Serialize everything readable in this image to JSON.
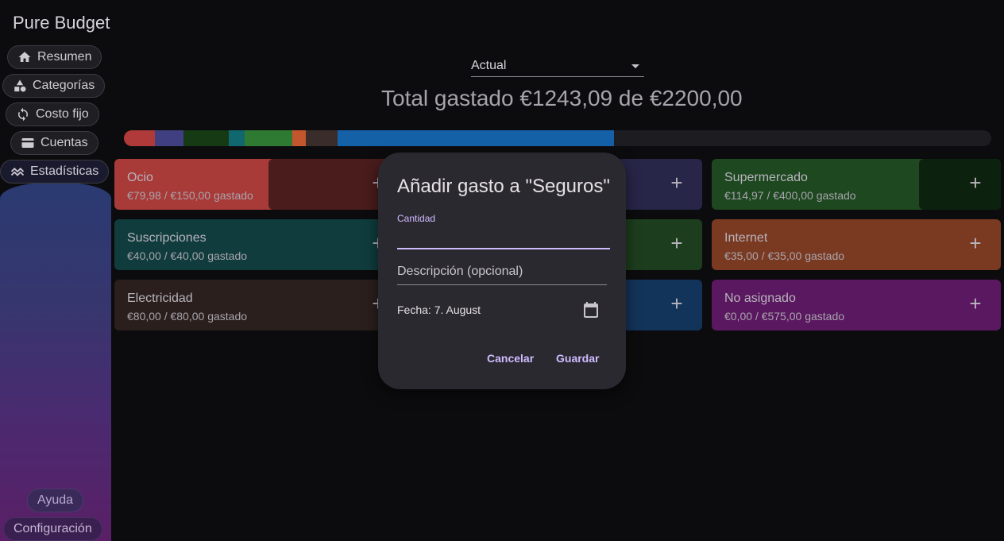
{
  "app": {
    "title": "Pure Budget"
  },
  "sidebar": {
    "items": [
      {
        "label": "Resumen",
        "icon": "home-icon"
      },
      {
        "label": "Categorías",
        "icon": "shapes-icon"
      },
      {
        "label": "Costo fijo",
        "icon": "sync-icon"
      },
      {
        "label": "Cuentas",
        "icon": "wallet-icon"
      },
      {
        "label": "Estadísticas",
        "icon": "stats-icon"
      }
    ],
    "footer": [
      {
        "label": "Ayuda"
      },
      {
        "label": "Configuración"
      }
    ]
  },
  "header": {
    "period": "Actual",
    "total": "Total gastado €1243,09 de €2200,00"
  },
  "budget_bar": {
    "segments": [
      {
        "color": "#b03a3a",
        "share": 0.036
      },
      {
        "color": "#3f3f82",
        "share": 0.033
      },
      {
        "color": "#153a14",
        "share": 0.052
      },
      {
        "color": "#10686e",
        "share": 0.018
      },
      {
        "color": "#2f7a32",
        "share": 0.055
      },
      {
        "color": "#c4562e",
        "share": 0.016
      },
      {
        "color": "#3a2c2a",
        "share": 0.036
      },
      {
        "color": "#1561a8",
        "share": 0.319
      }
    ]
  },
  "categories": [
    {
      "name": "Ocio",
      "amount": "€79,98 / €150,00 gastado",
      "bg": "#a83a38",
      "fill": "#4a1c1c",
      "remaining": 0.467
    },
    {
      "name": "",
      "amount": "",
      "bg": "#272648",
      "fill": "#272648",
      "remaining": 0
    },
    {
      "name": "Supermercado",
      "amount": "€114,97 / €400,00 gastado",
      "bg": "#1e4820",
      "fill": "#0d220e",
      "remaining": 0.283
    },
    {
      "name": "Suscripciones",
      "amount": "€40,00 / €40,00 gastado",
      "bg": "#103c3e",
      "fill": "#103c3e",
      "remaining": 0
    },
    {
      "name": "",
      "amount": "",
      "bg": "#1d3e1e",
      "fill": "#1d3e1e",
      "remaining": 0
    },
    {
      "name": "Internet",
      "amount": "€35,00 / €35,00 gastado",
      "bg": "#7a3a22",
      "fill": "#7a3a22",
      "remaining": 0
    },
    {
      "name": "Electricidad",
      "amount": "€80,00 / €80,00 gastado",
      "bg": "#2a1f1d",
      "fill": "#2a1f1d",
      "remaining": 0
    },
    {
      "name": "",
      "amount": "",
      "bg": "#13345a",
      "fill": "#13345a",
      "remaining": 0
    },
    {
      "name": "No asignado",
      "amount": "€0,00 / €575,00 gastado",
      "bg": "#5a1860",
      "fill": "#5a1860",
      "remaining": 0
    }
  ],
  "dialog": {
    "title": "Añadir gasto a \"Seguros\"",
    "amount_label": "Cantidad",
    "amount_value": "",
    "description_placeholder": "Descripción (opcional)",
    "date_text": "Fecha: 7. August",
    "cancel_label": "Cancelar",
    "save_label": "Guardar"
  }
}
